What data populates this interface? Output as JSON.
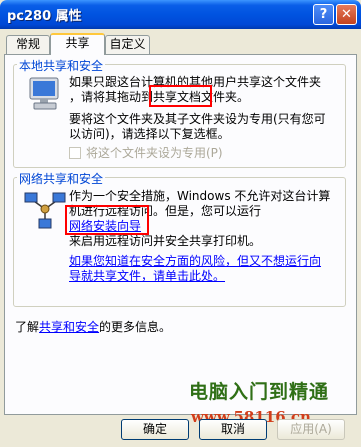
{
  "window": {
    "title": "pc280 属性",
    "help_glyph": "?",
    "close_glyph": "✕"
  },
  "tabs": [
    {
      "label": "常规",
      "active": false
    },
    {
      "label": "共享",
      "active": true
    },
    {
      "label": "自定义",
      "active": false
    }
  ],
  "local_sharing": {
    "title": "本地共享和安全",
    "line1": "如果只跟这台计算机的其他用户共享这个文件夹",
    "line2": "，请将其拖动到共享文档文件夹。",
    "line3": "要将这个文件夹及其子文件夹设为专用(只有您可",
    "line4": "以访问)，请选择以下复选框。",
    "private_checkbox": "将这个文件夹设为专用(P)",
    "private_checked": false
  },
  "network_sharing": {
    "title": "网络共享和安全",
    "line1": "作为一个安全措施，Windows 不允许对这台计算",
    "line2": "机进行远程访问。但是，您可以运行",
    "wizard_link": "网络安装向导",
    "line3": "来启用远程访问并安全共享打印机。",
    "risk_link_line1": "如果您知道在安全方面的风险，但又不想运行向",
    "risk_link_line2": "导就共享文件，请单击此处。"
  },
  "footer_info": {
    "prefix": "了解",
    "link": "共享和安全",
    "suffix": "的更多信息。"
  },
  "buttons": {
    "ok": "确定",
    "cancel": "取消",
    "apply": "应用(A)"
  },
  "watermark": {
    "line1": "电脑入门到精通",
    "line2": "www.58116.cn"
  },
  "colors": {
    "titlebar": "#0053e0",
    "group_title": "#0046d5",
    "link": "#0000ff",
    "highlight_box": "#ff0000",
    "watermark_green": "#2f6f16",
    "watermark_red": "#d23d1a"
  }
}
